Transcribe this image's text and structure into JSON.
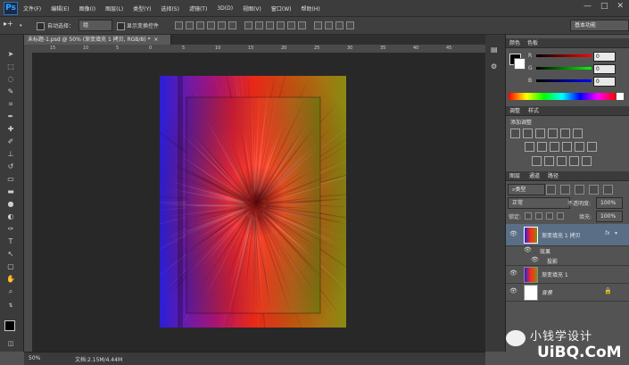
{
  "app": {
    "logo": "Ps",
    "menu": [
      "文件(F)",
      "编辑(E)",
      "图像(I)",
      "图层(L)",
      "类型(Y)",
      "选择(S)",
      "滤镜(T)",
      "3D(D)",
      "视图(V)",
      "窗口(W)",
      "帮助(H)"
    ],
    "window_controls": [
      "—",
      "□",
      "✕"
    ]
  },
  "options_bar": {
    "auto_select_label": "自动选择：",
    "auto_select_value": "组",
    "show_transform_label": "显示变换控件",
    "workspace": "基本功能"
  },
  "document": {
    "tab_title": "未标题-1.psd @ 50% (渐变填充 1 拷贝, RGB/8) *",
    "ruler_marks": [
      "15",
      "10",
      "5",
      "0",
      "5",
      "10",
      "15",
      "20",
      "25",
      "30",
      "35",
      "40",
      "45"
    ]
  },
  "status": {
    "zoom": "50%",
    "doc_size": "文档:2.15M/4.44M"
  },
  "color_panel": {
    "tabs": [
      "颜色",
      "色板"
    ],
    "channels": [
      {
        "label": "R",
        "value": "0"
      },
      {
        "label": "G",
        "value": "0"
      },
      {
        "label": "B",
        "value": "0"
      }
    ]
  },
  "adjustments_panel": {
    "tabs": [
      "调整",
      "样式"
    ],
    "title": "添加调整"
  },
  "layers_panel": {
    "tabs": [
      "图层",
      "通道",
      "路径"
    ],
    "filter_kind": "类型",
    "blend_mode": "正常",
    "opacity_label": "不透明度:",
    "opacity_value": "100%",
    "lock_label": "锁定:",
    "fill_label": "填充:",
    "fill_value": "100%",
    "layers": [
      {
        "name": "渐变填充 1 拷贝",
        "fx": "fx",
        "selected": true
      },
      {
        "name": "效果",
        "sub": true
      },
      {
        "name": "投影",
        "sub": true
      },
      {
        "name": "渐变填充 1",
        "selected": false
      },
      {
        "name": "背景",
        "locked": true
      }
    ]
  },
  "watermark": {
    "text": "小钱学设计",
    "url": "UiBQ.CoM"
  },
  "colors": {
    "accent": "#2f74c0",
    "selected_layer": "#5a6f86"
  }
}
